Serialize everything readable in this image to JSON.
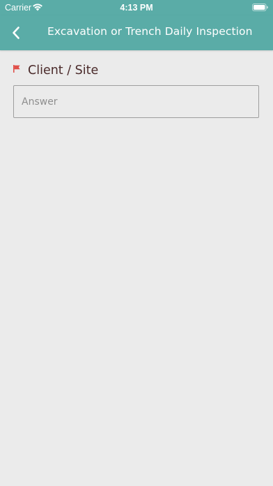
{
  "status_bar": {
    "carrier": "Carrier",
    "time": "4:13 PM",
    "wifi_icon": "wifi-icon",
    "battery_icon": "battery-icon"
  },
  "nav": {
    "back_icon": "chevron-left-icon",
    "title": "Excavation or Trench Daily Inspection"
  },
  "question": {
    "flag_icon": "flag-icon",
    "label": "Client / Site",
    "answer_value": "",
    "answer_placeholder": "Answer"
  },
  "colors": {
    "header": "#5aaca7",
    "background": "#ebebeb",
    "flag": "#e0504a",
    "label": "#4a2a2a"
  }
}
